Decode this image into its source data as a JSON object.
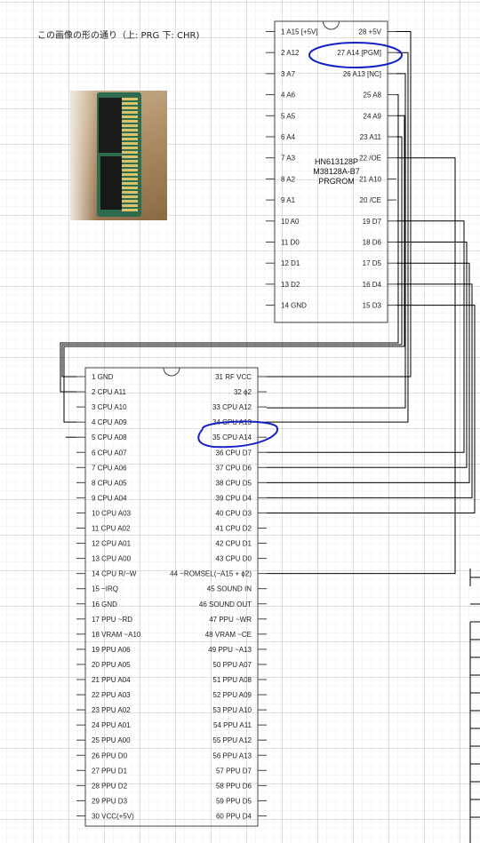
{
  "caption": "この画像の形の通り（上: PRG 下: CHR)",
  "photo": {
    "alt": "cartridge-board-photo",
    "board_color": "#2f6b4f"
  },
  "colors": {
    "line": "#000000",
    "box_border": "#444444",
    "pin_text": "#222222",
    "highlight": "#1520c8"
  },
  "rom_chip": {
    "part_label": [
      "HN613128P",
      "M38128A-B7",
      "PRGROM"
    ],
    "left_pins": [
      "1 A15 [+5V]",
      "2 A12",
      "3 A7",
      "4 A6",
      "5 A5",
      "6 A4",
      "7 A3",
      "8 A2",
      "9 A1",
      "10 A0",
      "11 D0",
      "12 D1",
      "13 D2",
      "14 GND"
    ],
    "right_pins": [
      "28 +5V",
      "27 A14 [PGM]",
      "26 A13 [NC]",
      "25 A8",
      "24 A9",
      "23 A11",
      "22 /OE",
      "21 A10",
      "20 /CE",
      "19 D7",
      "18 D6",
      "17 D5",
      "16 D4",
      "15 D3"
    ]
  },
  "cart_connector": {
    "left_pins": [
      "1 GND",
      "2 CPU A11",
      "3 CPU A10",
      "4 CPU A09",
      "5 CPU A08",
      "6 CPU A07",
      "7 CPU A06",
      "8 CPU A05",
      "9 CPU A04",
      "10 CPU A03",
      "11 CPU A02",
      "12 CPU A01",
      "13 CPU A00",
      "14 CPU R/~W",
      "15 ~IRQ",
      "16 GND",
      "17 PPU ~RD",
      "18 VRAM ~A10",
      "19 PPU A06",
      "20 PPU A05",
      "21 PPU A04",
      "22 PPU A03",
      "23 PPU A02",
      "24 PPU A01",
      "25 PPU A00",
      "26 PPU D0",
      "27 PPU D1",
      "28 PPU D2",
      "29 PPU D3",
      "30 VCC(+5V)"
    ],
    "right_pins": [
      "31 RF VCC",
      "32 ϕ2",
      "33 CPU A12",
      "34 CPU A13",
      "35 CPU A14",
      "36 CPU D7",
      "37 CPU D6",
      "38 CPU D5",
      "39 CPU D4",
      "40 CPU D3",
      "41 CPU D2",
      "42 CPU D1",
      "43 CPU D0",
      "44 ~ROMSEL(~A15 + ϕ2)",
      "45 SOUND IN",
      "46 SOUND OUT",
      "47 PPU ~WR",
      "48 VRAM ~CE",
      "49 PPU ~A13",
      "50 PPU A07",
      "51 PPU A08",
      "52 PPU A09",
      "53 PPU A10",
      "54 PPU A11",
      "55 PPU A12",
      "56 PPU A13",
      "57 PPU D7",
      "58 PPU D6",
      "59 PPU D5",
      "60 PPU D4"
    ]
  }
}
